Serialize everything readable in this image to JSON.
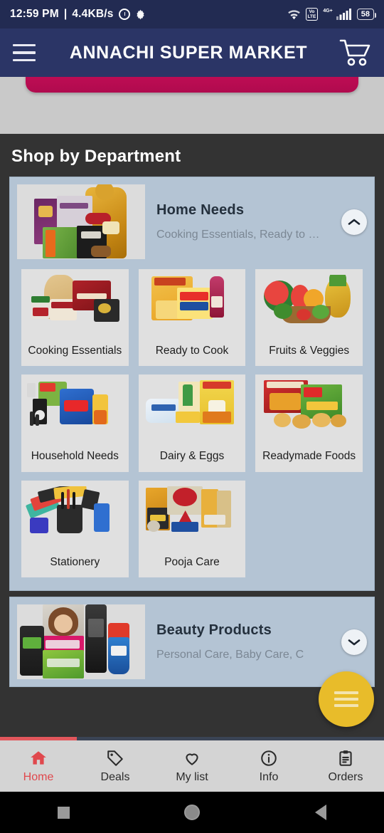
{
  "status_bar": {
    "time": "12:59 PM",
    "separator": "|",
    "network_speed": "4.4KB/s",
    "alarm_icon": "alarm-clock-icon",
    "settings_icon": "gear-icon",
    "wifi_icon": "wifi-icon",
    "volte_label": "VoLTE",
    "network_type": "4G+",
    "signal_icon": "signal-bars-icon",
    "battery_level": "58"
  },
  "app_bar": {
    "menu_icon": "hamburger-menu-icon",
    "title": "ANNACHI SUPER MARKET",
    "cart_icon": "shopping-cart-icon",
    "background_color": "#2b3566"
  },
  "banner": {
    "color": "#c4105a"
  },
  "section": {
    "heading": "Shop by Department",
    "background_color": "#333333"
  },
  "departments": [
    {
      "name": "Home Needs",
      "subtitle": "Cooking Essentials, Ready to …",
      "expanded": true,
      "toggle_icon": "chevron-up-icon",
      "categories": [
        {
          "label": "Cooking Essentials"
        },
        {
          "label": "Ready to Cook"
        },
        {
          "label": "Fruits & Veggies"
        },
        {
          "label": "Household Needs"
        },
        {
          "label": "Dairy & Eggs"
        },
        {
          "label": "Readymade Foods"
        },
        {
          "label": "Stationery"
        },
        {
          "label": "Pooja Care"
        }
      ]
    },
    {
      "name": "Beauty Products",
      "subtitle": "Personal Care, Baby Care, C",
      "expanded": false,
      "toggle_icon": "chevron-down-icon",
      "categories": []
    }
  ],
  "fab": {
    "icon": "menu-lines-icon",
    "color": "#e8bc2a"
  },
  "bottom_nav": {
    "active_color": "#e0484d",
    "items": [
      {
        "label": "Home",
        "icon": "home-icon",
        "active": true
      },
      {
        "label": "Deals",
        "icon": "tag-icon",
        "active": false
      },
      {
        "label": "My list",
        "icon": "heart-icon",
        "active": false
      },
      {
        "label": "Info",
        "icon": "info-circle-icon",
        "active": false
      },
      {
        "label": "Orders",
        "icon": "clipboard-icon",
        "active": false
      }
    ]
  },
  "android_nav": {
    "recents_icon": "square-icon",
    "home_icon": "circle-icon",
    "back_icon": "triangle-left-icon"
  }
}
